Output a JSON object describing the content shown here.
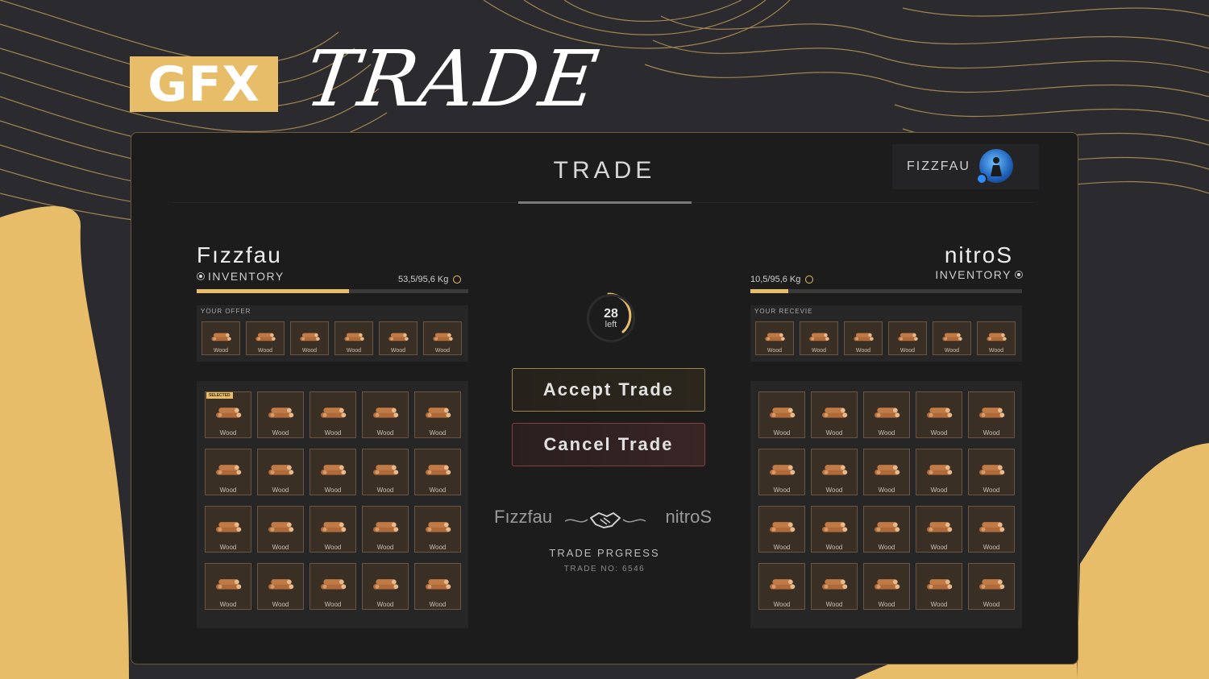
{
  "brand": {
    "badge": "GFX",
    "title": "TRADE"
  },
  "panel": {
    "title": "TRADE"
  },
  "user": {
    "name": "FIZZFAU"
  },
  "left": {
    "name": "Fızzfau",
    "inventory_label": "INVENTORY",
    "weight": "53,5/95,6 Kg",
    "weight_fraction": 0.56,
    "offer_label": "YOUR OFFER",
    "offer_items": [
      "Wood",
      "Wood",
      "Wood",
      "Wood",
      "Wood",
      "Wood"
    ],
    "selected_badge": "SELECTED",
    "grid_items": [
      "Wood",
      "Wood",
      "Wood",
      "Wood",
      "Wood",
      "Wood",
      "Wood",
      "Wood",
      "Wood",
      "Wood",
      "Wood",
      "Wood",
      "Wood",
      "Wood",
      "Wood",
      "Wood",
      "Wood",
      "Wood",
      "Wood",
      "Wood"
    ]
  },
  "right": {
    "name": "nitroS",
    "inventory_label": "INVENTORY",
    "weight": "10,5/95,6 Kg",
    "weight_fraction": 0.14,
    "receive_label": "YOUR RECEVIE",
    "receive_items": [
      "Wood",
      "Wood",
      "Wood",
      "Wood",
      "Wood",
      "Wood"
    ],
    "grid_items": [
      "Wood",
      "Wood",
      "Wood",
      "Wood",
      "Wood",
      "Wood",
      "Wood",
      "Wood",
      "Wood",
      "Wood",
      "Wood",
      "Wood",
      "Wood",
      "Wood",
      "Wood",
      "Wood",
      "Wood",
      "Wood",
      "Wood",
      "Wood"
    ]
  },
  "timer": {
    "value": "28",
    "label": "left"
  },
  "buttons": {
    "accept": "Accept Trade",
    "cancel": "Cancel Trade"
  },
  "handshake": {
    "left": "Fızzfau",
    "right": "nitroS",
    "icon": "handshake-icon"
  },
  "progress": {
    "label": "TRADE PRGRESS",
    "trade_no": "TRADE NO: 6546"
  },
  "colors": {
    "accent": "#e8bd6a",
    "panel": "#1c1c1d",
    "cancel_border": "#8a3e3e"
  }
}
